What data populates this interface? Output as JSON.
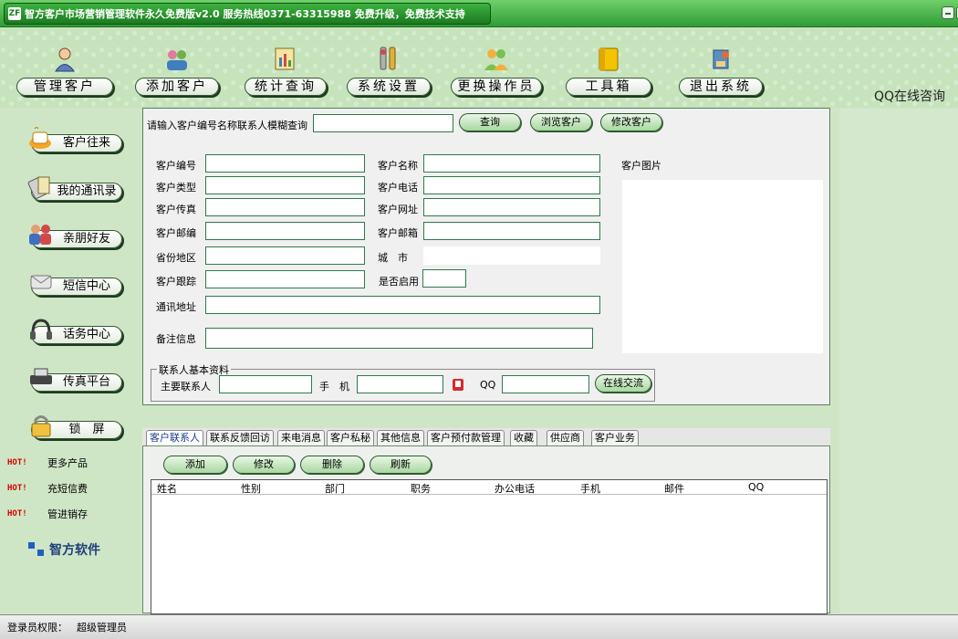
{
  "window": {
    "title_logo": "ZF",
    "title": "智方客户市场营销管理软件永久免费版v2.0 服务热线0371-63315988 免费升级，免费技术支持"
  },
  "toolbar": {
    "items": [
      {
        "label": "管理客户",
        "icon": "user-icon"
      },
      {
        "label": "添加客户",
        "icon": "add-users-icon"
      },
      {
        "label": "统计查询",
        "icon": "stats-icon"
      },
      {
        "label": "系统设置",
        "icon": "settings-icon"
      },
      {
        "label": "更换操作员",
        "icon": "switch-operator-icon"
      },
      {
        "label": "工具箱",
        "icon": "toolbox-icon"
      },
      {
        "label": "退出系统",
        "icon": "exit-icon"
      }
    ],
    "qq_online": "QQ在线咨询"
  },
  "sidebar": {
    "items": [
      {
        "label": "客户往来",
        "icon": "coffee-icon"
      },
      {
        "label": "我的通讯录",
        "icon": "address-book-icon"
      },
      {
        "label": "亲朋好友",
        "icon": "friends-icon"
      },
      {
        "label": "短信中心",
        "icon": "sms-icon"
      },
      {
        "label": "话务中心",
        "icon": "headset-icon"
      },
      {
        "label": "传真平台",
        "icon": "fax-icon"
      },
      {
        "label": "锁　屏",
        "icon": "lock-icon"
      }
    ],
    "hot_badge": "HOT!",
    "hot_links": [
      "更多产品",
      "充短信费",
      "管进销存"
    ],
    "brand": "智方软件"
  },
  "search": {
    "label": "请输入客户编号名称联系人模糊查询",
    "value": "",
    "query_button": "查询",
    "browse_button": "浏览客户",
    "edit_button": "修改客户"
  },
  "form": {
    "customer_id": "客户编号",
    "customer_name": "客户名称",
    "customer_type": "客户类型",
    "customer_phone": "客户电话",
    "customer_fax": "客户传真",
    "customer_website": "客户网址",
    "customer_zip": "客户邮编",
    "customer_email": "客户邮箱",
    "province": "省份地区",
    "city": "城　市",
    "follow_up": "客户跟踪",
    "enabled": "是否启用",
    "address": "通讯地址",
    "notes": "备注信息",
    "picture": "客户图片"
  },
  "contact": {
    "group_title": "联系人基本资料",
    "primary_contact": "主要联系人",
    "mobile": "手　机",
    "qq": "QQ",
    "chat_button": "在线交流"
  },
  "tabs": [
    "客户联系人",
    "联系反馈回访",
    "来电消息",
    "客户私秘",
    "其他信息",
    "客户预付款管理",
    "收藏",
    "供应商",
    "客户业务"
  ],
  "tab_actions": {
    "add": "添加",
    "edit": "修改",
    "delete": "删除",
    "refresh": "刷新"
  },
  "grid": {
    "columns": [
      "姓名",
      "性别",
      "部门",
      "职务",
      "办公电话",
      "手机",
      "邮件",
      "QQ"
    ]
  },
  "status": {
    "label": "登录员权限：",
    "value": "超级管理员"
  }
}
